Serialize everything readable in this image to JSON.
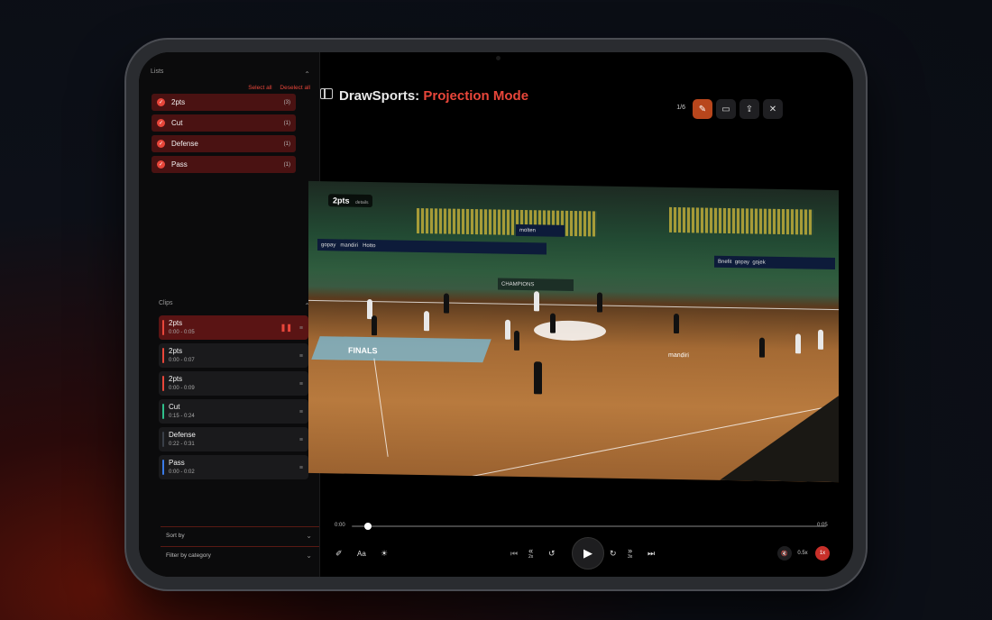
{
  "sidebar": {
    "lists_title": "Lists",
    "select_all": "Select all",
    "deselect_all": "Deselect all",
    "lists": [
      {
        "label": "2pts",
        "count": "(3)"
      },
      {
        "label": "Cut",
        "count": "(1)"
      },
      {
        "label": "Defense",
        "count": "(1)"
      },
      {
        "label": "Pass",
        "count": "(1)"
      }
    ],
    "clips_title": "Clips",
    "clips": [
      {
        "name": "2pts",
        "time": "0:00 - 0:05",
        "color": "#e8463a"
      },
      {
        "name": "2pts",
        "time": "0:00 - 0:07",
        "color": "#e8463a"
      },
      {
        "name": "2pts",
        "time": "0:00 - 0:09",
        "color": "#e8463a"
      },
      {
        "name": "Cut",
        "time": "0:15 - 0:24",
        "color": "#2fbf8a"
      },
      {
        "name": "Defense",
        "time": "0:22 - 0:31",
        "color": "#3a3f48"
      },
      {
        "name": "Pass",
        "time": "0:00 - 0:02",
        "color": "#3a7be8"
      }
    ],
    "sort_by": "Sort by",
    "filter_by": "Filter by category"
  },
  "header": {
    "title_main": "DrawSports:",
    "title_accent": "Projection Mode",
    "counter": "1/6"
  },
  "video": {
    "overlay_label": "2pts",
    "overlay_sub": "details",
    "banners": [
      "gopay",
      "mandiri",
      "Hotto",
      "molten",
      "Bnefit",
      "gopay",
      "gojek",
      "CHAMPIONS",
      "FINALS",
      "mandiri"
    ]
  },
  "player": {
    "time_start": "0:00",
    "time_end": "0:05",
    "progress": 0.03,
    "speed_options": [
      "0.5x",
      "1x"
    ],
    "speed_selected": "1x",
    "rewind_label": "2x",
    "ff_label": "3x"
  },
  "colors": {
    "accent": "#e8463a",
    "active_tool": "#b8461c"
  }
}
